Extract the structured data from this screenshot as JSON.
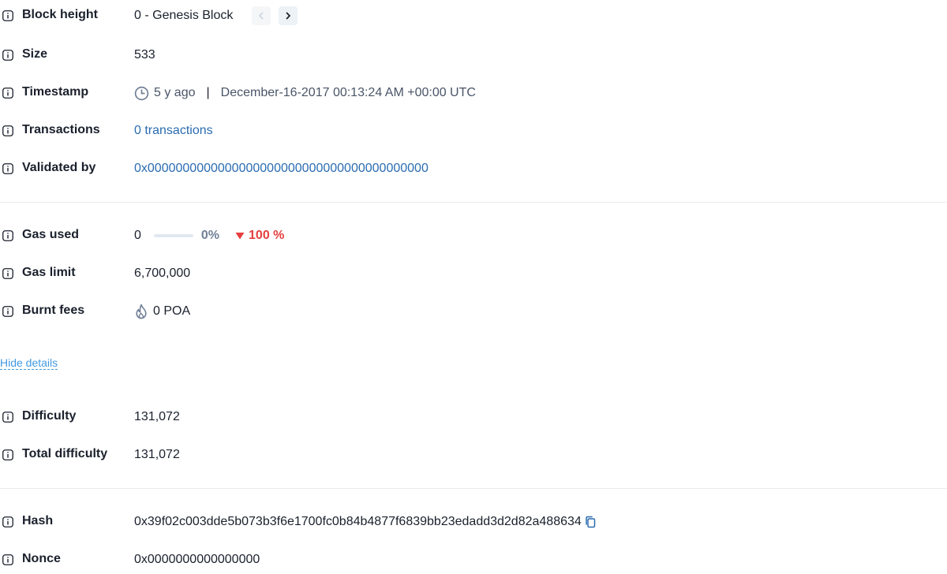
{
  "colors": {
    "link": "#2b6cb0",
    "negative": "#e53e3e",
    "muted": "#718096",
    "divider": "#e8ecf0"
  },
  "rows": {
    "block_height": {
      "label": "Block height",
      "value": "0 - Genesis Block"
    },
    "size": {
      "label": "Size",
      "value": "533"
    },
    "timestamp": {
      "label": "Timestamp",
      "relative": "5 y ago",
      "separator": "|",
      "absolute": "December-16-2017 00:13:24 AM +00:00 UTC"
    },
    "transactions": {
      "label": "Transactions",
      "value": "0 transactions"
    },
    "validated_by": {
      "label": "Validated by",
      "value": "0x0000000000000000000000000000000000000000"
    },
    "gas_used": {
      "label": "Gas used",
      "value": "0",
      "percent": "0%",
      "progress": 0,
      "delta": "100 %"
    },
    "gas_limit": {
      "label": "Gas limit",
      "value": "6,700,000"
    },
    "burnt_fees": {
      "label": "Burnt fees",
      "value": "0 POA"
    },
    "difficulty": {
      "label": "Difficulty",
      "value": "131,072"
    },
    "total_difficulty": {
      "label": "Total difficulty",
      "value": "131,072"
    },
    "hash": {
      "label": "Hash",
      "value": "0x39f02c003dde5b073b3f6e1700fc0b84b4877f6839bb23edadd3d2d82a488634"
    },
    "nonce": {
      "label": "Nonce",
      "value": "0x0000000000000000"
    }
  },
  "hide_details": "Hide details"
}
